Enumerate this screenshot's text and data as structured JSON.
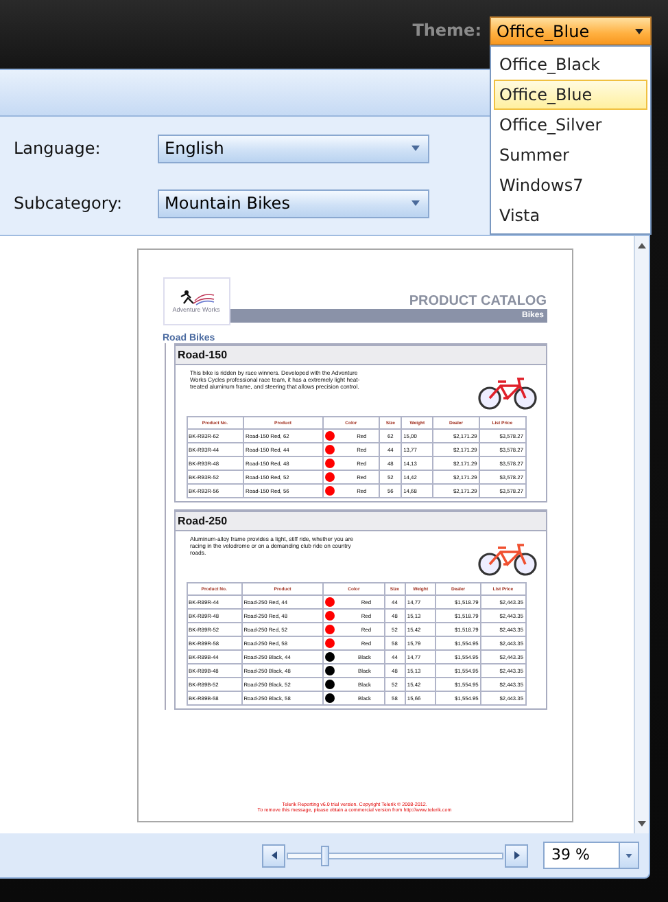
{
  "theme": {
    "label": "Theme:",
    "value": "Office_Blue",
    "options": [
      {
        "label": "Office_Black",
        "selected": false
      },
      {
        "label": "Office_Blue",
        "selected": true
      },
      {
        "label": "Office_Silver",
        "selected": false
      },
      {
        "label": "Summer",
        "selected": false
      },
      {
        "label": "Windows7",
        "selected": false
      },
      {
        "label": "Vista",
        "selected": false
      }
    ]
  },
  "parameters": [
    {
      "label": "Language:",
      "value": "English"
    },
    {
      "label": "Subcategory:",
      "value": "Mountain Bikes"
    }
  ],
  "report": {
    "title": "PRODUCT CATALOG",
    "category": "Bikes",
    "logo_text": "Adventure Works",
    "subcategory": "Road Bikes",
    "products": [
      {
        "name": "Road-150",
        "columns": [
          "Product No.",
          "Product",
          "Color",
          "Size",
          "Weight",
          "Dealer",
          "List Price"
        ],
        "description": "This bike is ridden by race winners. Developed with the Adventure Works Cycles professional race team, it has a extremely light heat-treated aluminum frame, and steering that allows precision control.",
        "rows": [
          {
            "number": "BK-R93R-62",
            "product": "Road-150 Red, 62",
            "color": "#ff0000",
            "color_name": "Red",
            "size": "62",
            "weight": "15,00",
            "dealer": "$2,171.29",
            "list_price": "$3,578.27"
          },
          {
            "number": "BK-R93R-44",
            "product": "Road-150 Red, 44",
            "color": "#ff0000",
            "color_name": "Red",
            "size": "44",
            "weight": "13,77",
            "dealer": "$2,171.29",
            "list_price": "$3,578.27"
          },
          {
            "number": "BK-R93R-48",
            "product": "Road-150 Red, 48",
            "color": "#ff0000",
            "color_name": "Red",
            "size": "48",
            "weight": "14,13",
            "dealer": "$2,171.29",
            "list_price": "$3,578.27"
          },
          {
            "number": "BK-R93R-52",
            "product": "Road-150 Red, 52",
            "color": "#ff0000",
            "color_name": "Red",
            "size": "52",
            "weight": "14,42",
            "dealer": "$2,171.29",
            "list_price": "$3,578.27"
          },
          {
            "number": "BK-R93R-56",
            "product": "Road-150 Red, 56",
            "color": "#ff0000",
            "color_name": "Red",
            "size": "56",
            "weight": "14,68",
            "dealer": "$2,171.29",
            "list_price": "$3,578.27"
          }
        ]
      },
      {
        "name": "Road-250",
        "columns": [
          "Product No.",
          "Product",
          "Color",
          "Size",
          "Weight",
          "Dealer",
          "List Price"
        ],
        "description": "Aluminum-alloy frame provides a light, stiff ride, whether you are racing in the velodrome or on a demanding club ride on country roads.",
        "rows": [
          {
            "number": "BK-R89R-44",
            "product": "Road-250 Red, 44",
            "color": "#ff0000",
            "color_name": "Red",
            "size": "44",
            "weight": "14,77",
            "dealer": "$1,518.79",
            "list_price": "$2,443.35"
          },
          {
            "number": "BK-R89R-48",
            "product": "Road-250 Red, 48",
            "color": "#ff0000",
            "color_name": "Red",
            "size": "48",
            "weight": "15,13",
            "dealer": "$1,518.79",
            "list_price": "$2,443.35"
          },
          {
            "number": "BK-R89R-52",
            "product": "Road-250 Red, 52",
            "color": "#ff0000",
            "color_name": "Red",
            "size": "52",
            "weight": "15,42",
            "dealer": "$1,518.79",
            "list_price": "$2,443.35"
          },
          {
            "number": "BK-R89R-58",
            "product": "Road-250 Red, 58",
            "color": "#ff0000",
            "color_name": "Red",
            "size": "58",
            "weight": "15,79",
            "dealer": "$1,554.95",
            "list_price": "$2,443.35"
          },
          {
            "number": "BK-R89B-44",
            "product": "Road-250 Black, 44",
            "color": "#000000",
            "color_name": "Black",
            "size": "44",
            "weight": "14,77",
            "dealer": "$1,554.95",
            "list_price": "$2,443.35"
          },
          {
            "number": "BK-R89B-48",
            "product": "Road-250 Black, 48",
            "color": "#000000",
            "color_name": "Black",
            "size": "48",
            "weight": "15,13",
            "dealer": "$1,554.95",
            "list_price": "$2,443.35"
          },
          {
            "number": "BK-R89B-52",
            "product": "Road-250 Black, 52",
            "color": "#000000",
            "color_name": "Black",
            "size": "52",
            "weight": "15,42",
            "dealer": "$1,554.95",
            "list_price": "$2,443.35"
          },
          {
            "number": "BK-R89B-58",
            "product": "Road-250 Black, 58",
            "color": "#000000",
            "color_name": "Black",
            "size": "58",
            "weight": "15,66",
            "dealer": "$1,554.95",
            "list_price": "$2,443.35"
          }
        ]
      }
    ],
    "footer": [
      "Telerik Reporting v6.0 trial version. Copyright Telerik © 2008-2012.",
      "To remove this message, please obtain a commercial version from http://www.telerik.com"
    ]
  },
  "zoom": {
    "level": 0.18,
    "value": "39 %"
  }
}
